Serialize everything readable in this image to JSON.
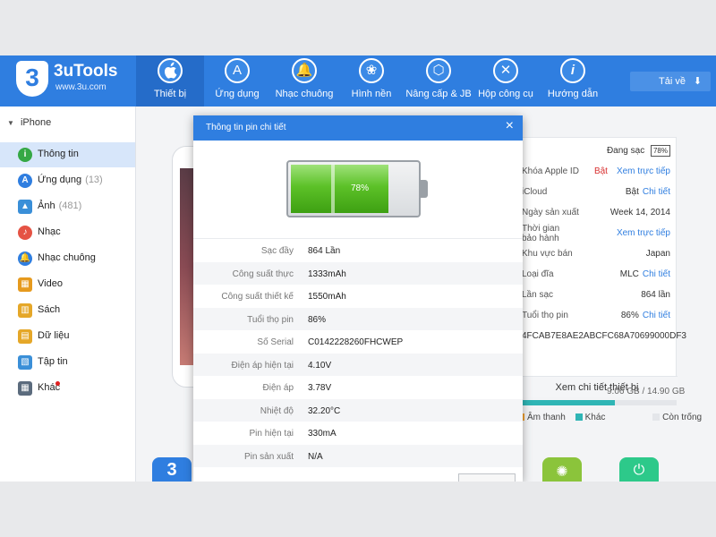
{
  "brand": {
    "name": "3uTools",
    "site": "www.3u.com",
    "logo_glyph": "3"
  },
  "nav": [
    {
      "label": "Thiết bị",
      "icon": "apple-icon",
      "glyph": "",
      "active": true
    },
    {
      "label": "Ứng dụng",
      "icon": "app-store-icon",
      "glyph": "A"
    },
    {
      "label": "Nhạc chuông",
      "icon": "bell-icon",
      "glyph": "🔔"
    },
    {
      "label": "Hình nền",
      "icon": "flower-icon",
      "glyph": "❀"
    },
    {
      "label": "Nâng cấp & JB",
      "icon": "box-icon",
      "glyph": "⬡"
    },
    {
      "label": "Hộp công cụ",
      "icon": "tools-icon",
      "glyph": "✕"
    },
    {
      "label": "Hướng dẫn",
      "icon": "info-icon",
      "glyph": "i"
    }
  ],
  "download": {
    "label": "Tải về",
    "icon": "download-icon"
  },
  "sidebar": {
    "device": "iPhone",
    "items": [
      {
        "label": "Thông tin",
        "count": "",
        "icon": "info-icon",
        "color": "#35a845",
        "glyph": "i",
        "active": true
      },
      {
        "label": "Ứng dụng",
        "count": "(13)",
        "icon": "app-store-icon",
        "color": "#2f7ee0",
        "glyph": "A"
      },
      {
        "label": "Ảnh",
        "count": "(481)",
        "icon": "photo-icon",
        "color": "#3a8fd8",
        "glyph": "▲"
      },
      {
        "label": "Nhạc",
        "count": "",
        "icon": "music-icon",
        "color": "#e55344",
        "glyph": "♪"
      },
      {
        "label": "Nhạc chuông",
        "count": "",
        "icon": "bell-icon",
        "color": "#2f7ee0",
        "glyph": "🔔"
      },
      {
        "label": "Video",
        "count": "",
        "icon": "video-icon",
        "color": "#e69a1e",
        "glyph": "▦"
      },
      {
        "label": "Sách",
        "count": "",
        "icon": "book-icon",
        "color": "#e5a728",
        "glyph": "▥"
      },
      {
        "label": "Dữ liệu",
        "count": "",
        "icon": "data-icon",
        "color": "#e5a728",
        "glyph": "▤"
      },
      {
        "label": "Tập tin",
        "count": "",
        "icon": "file-icon",
        "color": "#3a8fd8",
        "glyph": "▧"
      },
      {
        "label": "Khác",
        "count": "",
        "icon": "grid-icon",
        "color": "#5b6b7d",
        "glyph": "▦"
      }
    ]
  },
  "device_info": {
    "charging_label": "Đang sạc",
    "charging_percent": "78%",
    "rows": [
      {
        "key": "Khóa Apple ID",
        "red": "Bật",
        "link": "Xem trực tiếp"
      },
      {
        "key": "iCloud",
        "value": "Bật",
        "link": "Chi tiết"
      },
      {
        "key": "Ngày sản xuất",
        "value": "Week 14, 2014"
      },
      {
        "key": "Thời gian bảo hành",
        "link": "Xem trực tiếp"
      },
      {
        "key": "Khu vực bán",
        "value": "Japan"
      },
      {
        "key": "Loại đĩa",
        "value": "MLC",
        "link": "Chi tiết"
      },
      {
        "key": "Lần sạc",
        "value": "864 lần"
      },
      {
        "key": "Tuổi thọ pin",
        "value": "86%",
        "link": "Chi tiết"
      }
    ],
    "udid_partial": "4FCAB7E8AE2ABCFC68A70699000DF3",
    "see_detail_button": "Xem chi tiết thiết bị"
  },
  "storage": {
    "text": "9.06 GB / 14.90 GB",
    "used_fraction": 0.608,
    "legend": [
      {
        "label": "Âm thanh",
        "color": "#f0a030"
      },
      {
        "label": "Khác",
        "color": "#2fb5b5"
      },
      {
        "label": "Còn trống",
        "color": "#e4e6ea"
      }
    ]
  },
  "dialog": {
    "title": "Thông tin pin chi tiết",
    "close_glyph": "×",
    "battery_percent": "78%",
    "battery_level": 0.78,
    "rows": [
      {
        "key": "Sạc đầy",
        "value": "864 Lần"
      },
      {
        "key": "Công suất thực",
        "value": "1333mAh"
      },
      {
        "key": "Công suất thiết kế",
        "value": "1550mAh"
      },
      {
        "key": "Tuổi thọ pin",
        "value": "86%"
      },
      {
        "key": "Số Serial",
        "value": "C0142228260FHCWEP"
      },
      {
        "key": "Điện áp hiện tại",
        "value": "4.10V"
      },
      {
        "key": "Điện áp",
        "value": "3.78V"
      },
      {
        "key": "Nhiệt độ",
        "value": "32.20°C"
      },
      {
        "key": "Pin hiện tại",
        "value": "330mA"
      },
      {
        "key": "Pin sản xuất",
        "value": "N/A"
      }
    ]
  },
  "colors": {
    "accent": "#2f7ee0",
    "battery_green": "#5cc128",
    "danger": "#d83030"
  }
}
